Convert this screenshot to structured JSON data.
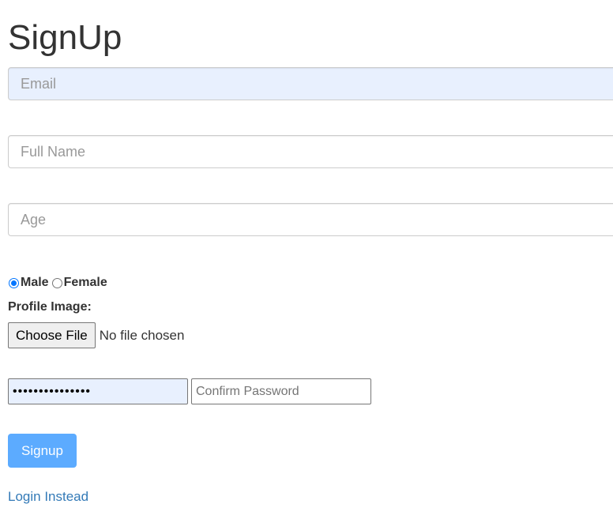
{
  "title": "SignUp",
  "fields": {
    "email_placeholder": "Email",
    "fullname_placeholder": "Full Name",
    "age_placeholder": "Age"
  },
  "gender": {
    "options": [
      "Male",
      "Female"
    ],
    "selected": "Male"
  },
  "profile_image": {
    "label": "Profile Image:",
    "button_label": "Choose File",
    "status": "No file chosen"
  },
  "password": {
    "value": "•••••••••••••••",
    "confirm_placeholder": "Confirm Password"
  },
  "signup_button": "Signup",
  "login_link": "Login Instead",
  "colors": {
    "autofill_bg": "#e8f0fe",
    "button_bg": "#5cabff",
    "link": "#337ab7",
    "radio_checked": "#0075ff"
  }
}
